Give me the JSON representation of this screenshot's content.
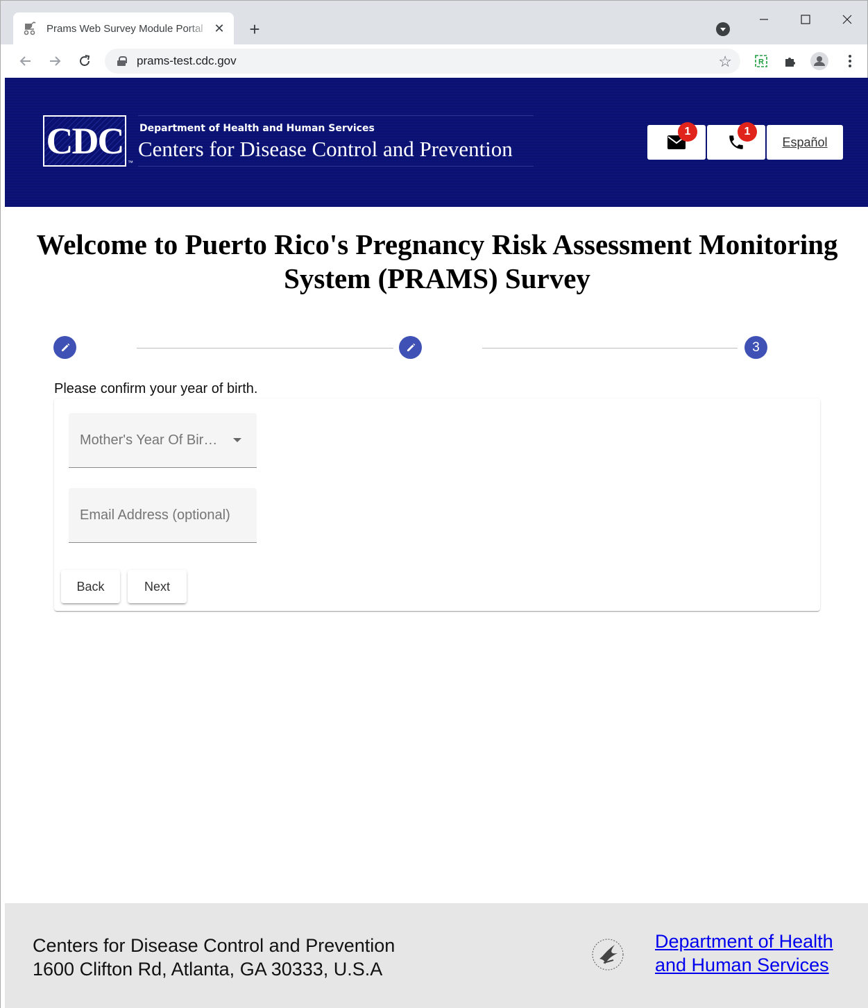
{
  "browser": {
    "tab_title": "Prams Web Survey Module Portal",
    "tab_close": "✕",
    "new_tab": "+",
    "url": "prams-test.cdc.gov"
  },
  "header": {
    "logo_text": "CDC",
    "logo_tm": "™",
    "dept_small": "Department of Health and Human Services",
    "dept_big": "Centers for Disease Control and Prevention",
    "mail_badge": "1",
    "phone_badge": "1",
    "language_link": "Español"
  },
  "main": {
    "title": "Welcome to Puerto Rico's Pregnancy Risk Assessment Monitoring System (PRAMS) Survey",
    "steps": [
      {
        "state": "edit"
      },
      {
        "state": "edit"
      },
      {
        "state": "active",
        "label": "3"
      }
    ],
    "prompt": "Please confirm your year of birth.",
    "year_select_label": "Mother's Year Of Bir…",
    "email_placeholder": "Email Address (optional)",
    "back_label": "Back",
    "next_label": "Next"
  },
  "footer": {
    "org_name": "Centers for Disease Control and Prevention",
    "address": "1600 Clifton Rd, Atlanta, GA 30333, U.S.A",
    "hhs_link_line1": "Department of Health",
    "hhs_link_line2": "and Human Services"
  },
  "colors": {
    "header_bg": "#0a1171",
    "step_blue": "#3f51b5",
    "badge_red": "#e1241b",
    "footer_bg": "#e6e6e6",
    "link": "#0000ee"
  }
}
